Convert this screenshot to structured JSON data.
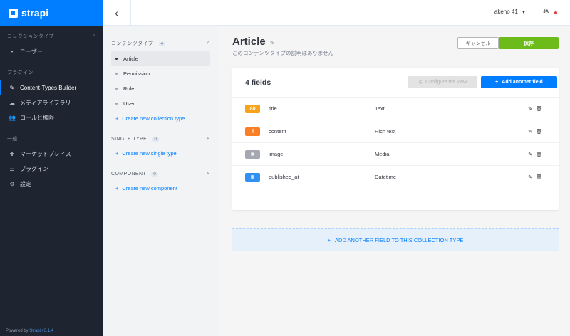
{
  "brand": {
    "name": "strapi",
    "color": "#007eff"
  },
  "left_nav": {
    "collections_title": "コレクションタイプ",
    "collections": [
      {
        "label": "ユーザー"
      }
    ],
    "plugins_title": "プラグイン",
    "plugins": [
      {
        "label": "Content-Types Builder",
        "icon": "brush-icon",
        "active": true
      },
      {
        "label": "メディアライブラリ",
        "icon": "cloud-upload-icon"
      },
      {
        "label": "ロールと権限",
        "icon": "users-icon"
      }
    ],
    "general_title": "一般",
    "general": [
      {
        "label": "マーケットプレイス",
        "icon": "puzzle-icon"
      },
      {
        "label": "プラグイン",
        "icon": "list-icon"
      },
      {
        "label": "設定",
        "icon": "gear-icon"
      }
    ],
    "powered_by": "Powered by",
    "powered_link": "Strapi v3.1.4"
  },
  "topbar": {
    "user": "akeno 41",
    "lang": "JA"
  },
  "sub_nav": {
    "content_types": {
      "title": "コンテンツタイプ",
      "count": "4",
      "items": [
        "Article",
        "Permission",
        "Role",
        "User"
      ],
      "create": "Create new collection type"
    },
    "single_types": {
      "title": "SINGLE TYPE",
      "count": "0",
      "create": "Create new single type"
    },
    "components": {
      "title": "COMPONENT",
      "count": "0",
      "create": "Create new component"
    }
  },
  "main": {
    "title": "Article",
    "description": "このコンテンツタイプの説明はありません",
    "cancel": "キャンセル",
    "save": "保存",
    "fields_count": "4 fields",
    "configure_view": "Configure the view",
    "add_field": "Add another field",
    "add_collection_field": "ADD ANOTHER FIELD TO THIS COLLECTION TYPE",
    "fields": [
      {
        "name": "title",
        "type": "Text",
        "icon_label": "Ab",
        "icon_color": "#f7a31c"
      },
      {
        "name": "content",
        "type": "Rich text",
        "icon_label": "¶",
        "icon_color": "#fa7e23"
      },
      {
        "name": "image",
        "type": "Media",
        "icon_label": "▣",
        "icon_color": "#a5a8b2"
      },
      {
        "name": "published_at",
        "type": "Datetime",
        "icon_label": "▦",
        "icon_color": "#3291f0"
      }
    ]
  }
}
